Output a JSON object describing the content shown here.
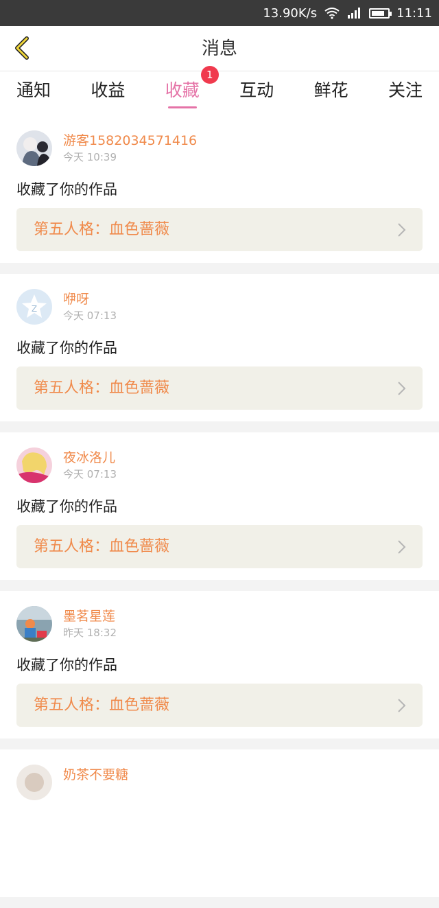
{
  "status_bar": {
    "speed": "13.90K/s",
    "time": "11:11"
  },
  "header": {
    "title": "消息"
  },
  "tabs": [
    {
      "label": "通知"
    },
    {
      "label": "收益"
    },
    {
      "label": "收藏",
      "badge": "1"
    },
    {
      "label": "互动"
    },
    {
      "label": "鲜花"
    },
    {
      "label": "关注"
    }
  ],
  "colors": {
    "accent_pink": "#e573a7",
    "name_orange": "#f08a4b",
    "badge_red": "#f03a4e"
  },
  "messages": [
    {
      "name": "游客15820345714​16",
      "time": "今天 10:39",
      "action": "收藏了你的作品",
      "work_title": "第五人格：血色蔷薇"
    },
    {
      "name": "咿呀",
      "time": "今天 07:13",
      "action": "收藏了你的作品",
      "work_title": "第五人格：血色蔷薇"
    },
    {
      "name": "夜冰洛儿",
      "time": "今天 07:13",
      "action": "收藏了你的作品",
      "work_title": "第五人格：血色蔷薇"
    },
    {
      "name": "墨茗星莲",
      "time": "昨天 18:32",
      "action": "收藏了你的作品",
      "work_title": "第五人格：血色蔷薇"
    },
    {
      "name": "奶茶不要糖",
      "time": "",
      "action": "",
      "work_title": ""
    }
  ]
}
